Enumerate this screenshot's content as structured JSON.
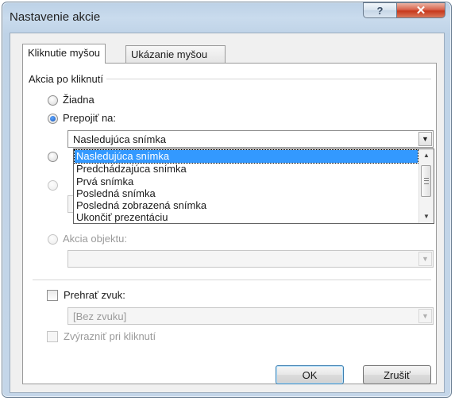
{
  "window": {
    "title": "Nastavenie akcie",
    "help_glyph": "?",
    "close_glyph": "✕"
  },
  "tabs": [
    {
      "label": "Kliknutie myšou",
      "active": true
    },
    {
      "label": "Ukázanie myšou",
      "active": false
    }
  ],
  "group": {
    "label": "Akcia po kliknutí"
  },
  "options": {
    "none": {
      "label": "Žiadna",
      "selected": false
    },
    "link": {
      "label": "Prepojiť na:",
      "selected": true,
      "value": "Nasledujúca snímka"
    },
    "object": {
      "label": "Akcia objektu:",
      "selected": false,
      "value": ""
    }
  },
  "dropdown": {
    "items": [
      "Nasledujúca snímka",
      "Predchádzajúca snímka",
      "Prvá snímka",
      "Posledná snímka",
      "Posledná zobrazená snímka",
      "Ukončiť prezentáciu"
    ],
    "selected_index": 0
  },
  "sound": {
    "label": "Prehrať zvuk:",
    "checked": false,
    "value": "[Bez zvuku]"
  },
  "highlight": {
    "label": "Zvýrazniť pri kliknutí",
    "checked": false
  },
  "buttons": {
    "ok": "OK",
    "cancel": "Zrušiť"
  },
  "icons": {
    "arrow_down": "▼",
    "arrow_up": "▲"
  },
  "colors": {
    "selection": "#3399ff",
    "frame": "#c4d6e9",
    "close": "#c7381c"
  }
}
